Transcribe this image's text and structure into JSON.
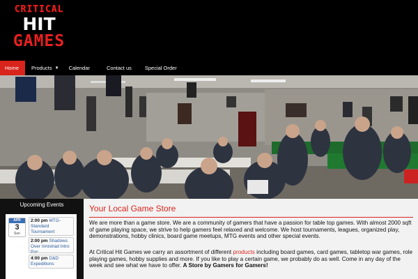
{
  "brand": {
    "line1": "CRITICAL",
    "line2": "HIT",
    "line3": "GAMES",
    "accent": "#d9241c"
  },
  "nav": {
    "items": [
      {
        "label": "Home",
        "active": true
      },
      {
        "label": "Products",
        "dropdown": true
      },
      {
        "label": "Calendar"
      },
      {
        "label": "Contact us"
      },
      {
        "label": "Special Order"
      }
    ],
    "dropdown_icon": "chevron-down-icon"
  },
  "sidebar": {
    "title": "Upcoming Events",
    "date": {
      "month": "APR",
      "day": "3",
      "weekday": "Sun"
    },
    "events": [
      {
        "time": "2:00 pm",
        "name": "MTG- Standard Tournament"
      },
      {
        "time": "2:00 pm",
        "name": "Shadows Over Innistrad Intro Pac..."
      },
      {
        "time": "4:00 pm",
        "name": "D&D Expeditions"
      }
    ]
  },
  "main": {
    "title": "Your Local Game Store",
    "para1": "We are more than a game store. We are a community of gamers that have a passion for table top games. With almost 2000 sqft of game playing space, we strive to help gamers feel relaxed and welcome. We host tournaments, leagues, organized play, demonstrations, hobby clinics, board game meetups, MTG events and other special events.",
    "para2_start": "At Critical Hit Games we carry an assortment of different ",
    "para2_link": "products",
    "para2_end": " including board games, card games, tabletop war games, role playing games, hobby supplies and more. If you like to play a certain game, we probably do as well. Come in any day of the week and see what we have to offer. ",
    "para2_bold": "A Store by Gamers for Gamers!"
  }
}
